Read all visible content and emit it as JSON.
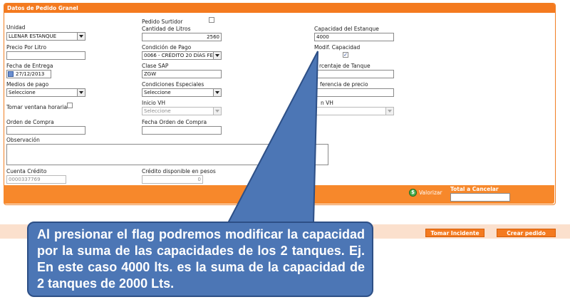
{
  "panel": {
    "title": "Datos de Pedido Granel"
  },
  "col1": {
    "unidad_label": "Unidad",
    "unidad_value": "LLENAR ESTANQUE",
    "precio_label": "Precio Por Litro",
    "precio_value": "",
    "fecha_entrega_label": "Fecha de Entrega",
    "fecha_entrega_value": "27/12/2013",
    "medios_pago_label": "Medios de pago",
    "medios_pago_value": "Seleccione",
    "tomar_ventana_label": "Tomar ventana horaria",
    "orden_compra_label": "Orden de Compra",
    "orden_compra_value": ""
  },
  "col2": {
    "pedido_surtidor_label": "Pedido Surtidor",
    "cantidad_label": "Cantidad de Litros",
    "cantidad_value": "2560",
    "condicion_label": "Condición de Pago",
    "condicion_value": "0066 - CRÉDITO 20 DÍAS FE",
    "clase_sap_label": "Clase SAP",
    "clase_sap_value": "ZGW",
    "condiciones_esp_label": "Condiciones Especiales",
    "condiciones_esp_value": "Seleccione",
    "inicio_vh_label": "Inicio VH",
    "inicio_vh_value": "Seleccione",
    "fecha_orden_label": "Fecha Orden de Compra",
    "fecha_orden_value": ""
  },
  "col3": {
    "capacidad_label": "Capacidad del Estanque",
    "capacidad_value": "4000",
    "modif_capacidad_label": "Modif. Capacidad",
    "modif_capacidad_checked": true,
    "porcentaje_label": "rcentaje de Tanque",
    "porcentaje_value": "",
    "diferencia_label": "ferencia de precio",
    "diferencia_value": "",
    "fin_vh_label": "n VH",
    "fin_vh_value": ""
  },
  "observacion": {
    "label": "Observación",
    "value": ""
  },
  "cuenta": {
    "label": "Cuenta Crédito",
    "value": "0000337769"
  },
  "credito": {
    "label": "Crédito disponible en pesos",
    "value": "0"
  },
  "footer": {
    "valorizar_label": "Valorizar",
    "total_label": "Total a Cancelar",
    "total_value": ""
  },
  "actions": {
    "tomar_incidente": "Tomar Incidente",
    "crear_pedido": "Crear pedido"
  },
  "callout": {
    "text": "Al presionar el flag podremos modificar la capacidad por la suma de las capacidades de los 2 tanques. Ej. En este caso 4000 lts. es la suma de la capacidad de 2 tanques de 2000 Lts."
  },
  "colors": {
    "accent": "#f47a1f",
    "callout": "#4c76b5",
    "callout_border": "#2d4f86"
  }
}
